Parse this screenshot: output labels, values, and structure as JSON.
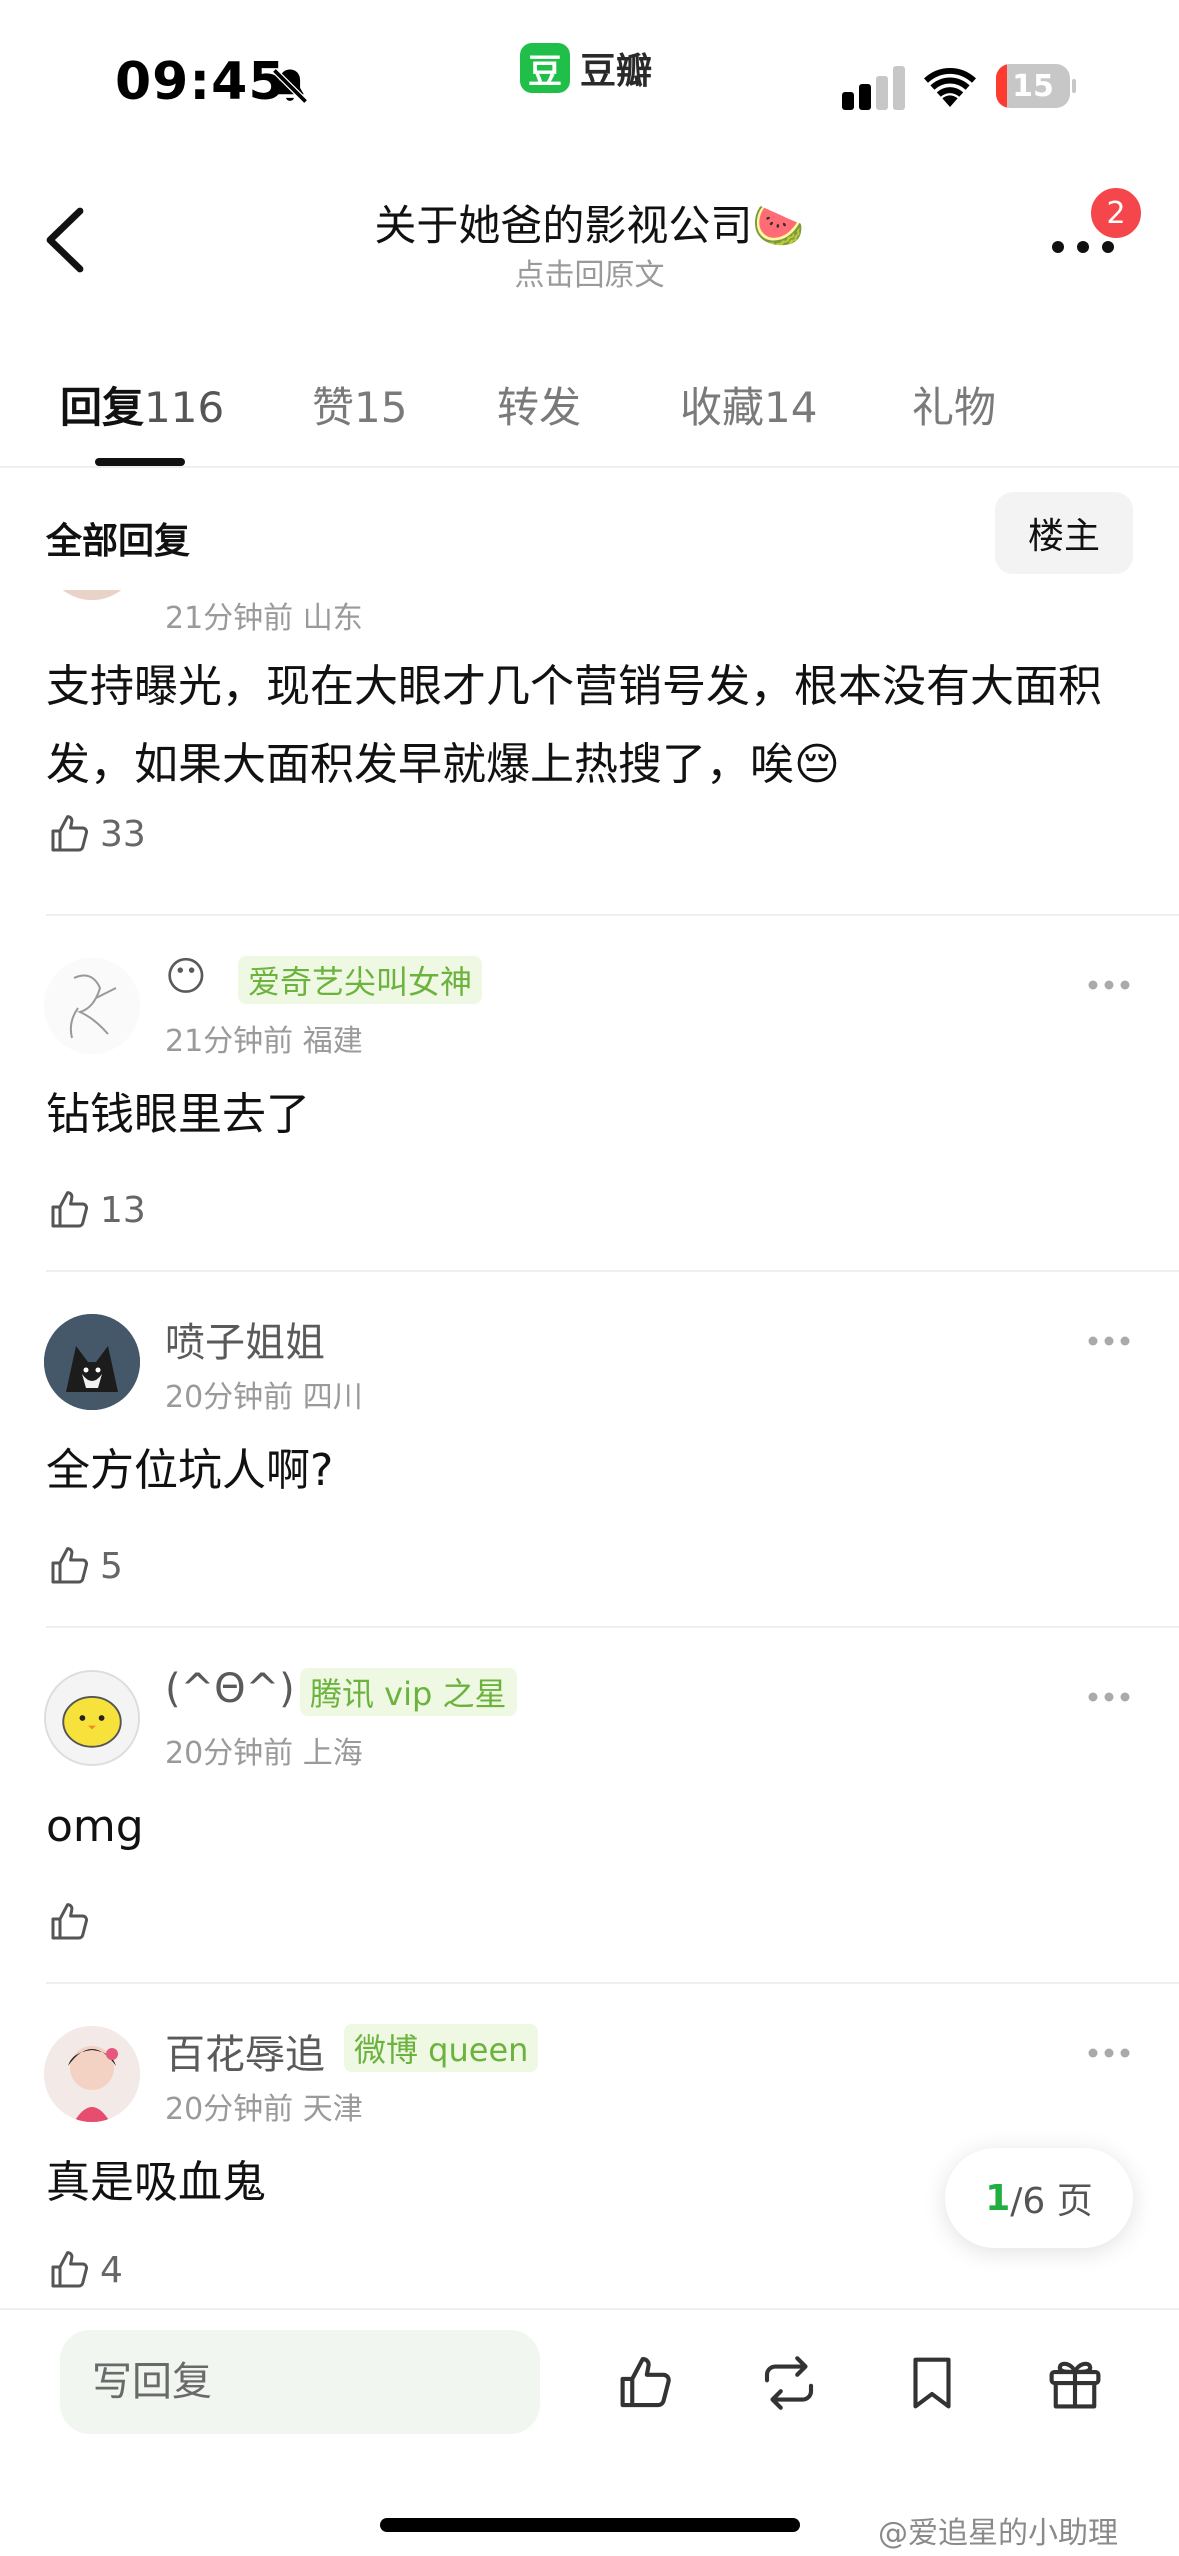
{
  "status_bar": {
    "time": "09:45",
    "app_name": "豆瓣",
    "app_logo_char": "豆",
    "battery": "15",
    "battery_level": 0.15,
    "icons": [
      "bell-slash-icon",
      "signal-icon",
      "wifi-icon",
      "battery-icon"
    ]
  },
  "nav": {
    "title": "关于她爸的影视公司🍉",
    "subtitle": "点击回原文",
    "badge_count": "2"
  },
  "tabs": [
    {
      "label": "回复",
      "count": "116"
    },
    {
      "label": "赞",
      "count": "15"
    },
    {
      "label": "转发",
      "count": ""
    },
    {
      "label": "收藏",
      "count": "14"
    },
    {
      "label": "礼物",
      "count": ""
    }
  ],
  "filter": {
    "label": "全部回复",
    "op_button": "楼主"
  },
  "comments": [
    {
      "name": "",
      "badge": "",
      "meta": "21分钟前 山东",
      "text": "支持曝光，现在大眼才几个营销号发，根本没有大面积发，如果大面积发早就爆上热搜了，唉😔",
      "likes": "33"
    },
    {
      "name": "😶",
      "badge": "爱奇艺尖叫女神",
      "meta": "21分钟前 福建",
      "text": "钻钱眼里去了",
      "likes": "13"
    },
    {
      "name": "喷子姐姐",
      "badge": "",
      "meta": "20分钟前 四川",
      "text": "全方位坑人啊?",
      "likes": "5"
    },
    {
      "name": "(^Θ^)",
      "badge": "腾讯 vip 之星",
      "meta": "20分钟前 上海",
      "text": "omg",
      "likes": ""
    },
    {
      "name": "百花辱追",
      "badge": "微博 queen",
      "meta": "20分钟前 天津",
      "text": "真是吸血鬼",
      "likes": "4"
    }
  ],
  "pagination": {
    "current": "1",
    "total_label": "/6 页"
  },
  "bottom_bar": {
    "reply_placeholder": "写回复",
    "watermark": "@爱追星的小助理"
  },
  "colors": {
    "accent_green": "#1fbf4a",
    "badge_green_text": "#6cb33e",
    "badge_green_bg": "#eef8e3",
    "notification_red": "#f5464b"
  }
}
